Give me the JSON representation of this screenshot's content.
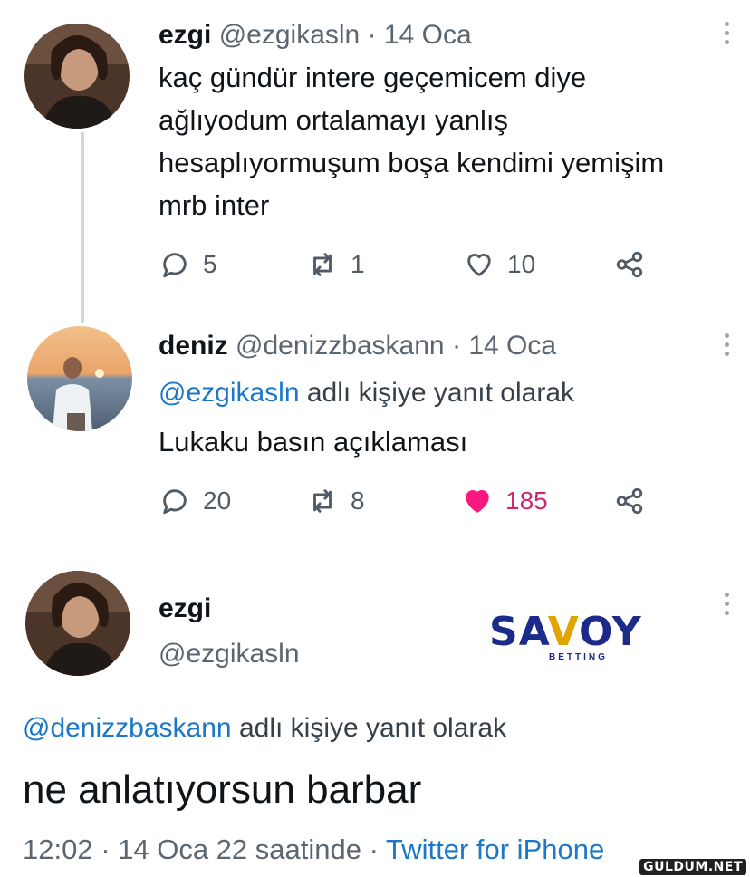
{
  "tweets": [
    {
      "name": "ezgi",
      "handle": "@ezgikasln",
      "separator": "·",
      "date": "14 Oca",
      "text_lines": [
        "kaç gündür intere geçemicem diye",
        "ağlıyodum ortalamayı yanlış",
        "hesaplıyormuşum boşa kendimi yemişim",
        "mrb inter"
      ],
      "replies": "5",
      "retweets": "1",
      "likes": "10",
      "liked": false,
      "avatar_icon": "woman-portrait-avatar"
    },
    {
      "name": "deniz",
      "handle": "@denizzbaskann",
      "separator": "·",
      "date": "14 Oca",
      "reply_to_handle": "@ezgikasln",
      "reply_to_suffix": " adlı kişiye yanıt olarak",
      "text": "Lukaku basın açıklaması",
      "replies": "20",
      "retweets": "8",
      "likes": "185",
      "liked": true,
      "like_color": "#f91880",
      "avatar_icon": "man-sunset-avatar"
    }
  ],
  "main_tweet": {
    "name": "ezgi",
    "handle": "@ezgikasln",
    "reply_to_handle": "@denizzbaskann",
    "reply_to_suffix": " adlı kişiye yanıt olarak",
    "text": "ne anlatıyorsun barbar",
    "timestamp": "12:02 · 14 Oca 22 saatinde · ",
    "client": "Twitter for iPhone",
    "avatar_icon": "woman-portrait-avatar"
  },
  "overlay": {
    "logo_word_a": "SA",
    "logo_word_v": "V",
    "logo_word_b": "OY",
    "logo_sub": "BETTING",
    "watermark": "GULDUM.NET"
  },
  "icons": {
    "reply": "reply-bubble-icon",
    "retweet": "retweet-icon",
    "like": "heart-icon",
    "share": "share-icon",
    "more": "more-vertical-icon"
  },
  "colors": {
    "link": "#1d77c8",
    "text": "#0f1419",
    "muted": "#5b6670",
    "like_active": "#f91880",
    "brand": "#1c2a8a"
  }
}
